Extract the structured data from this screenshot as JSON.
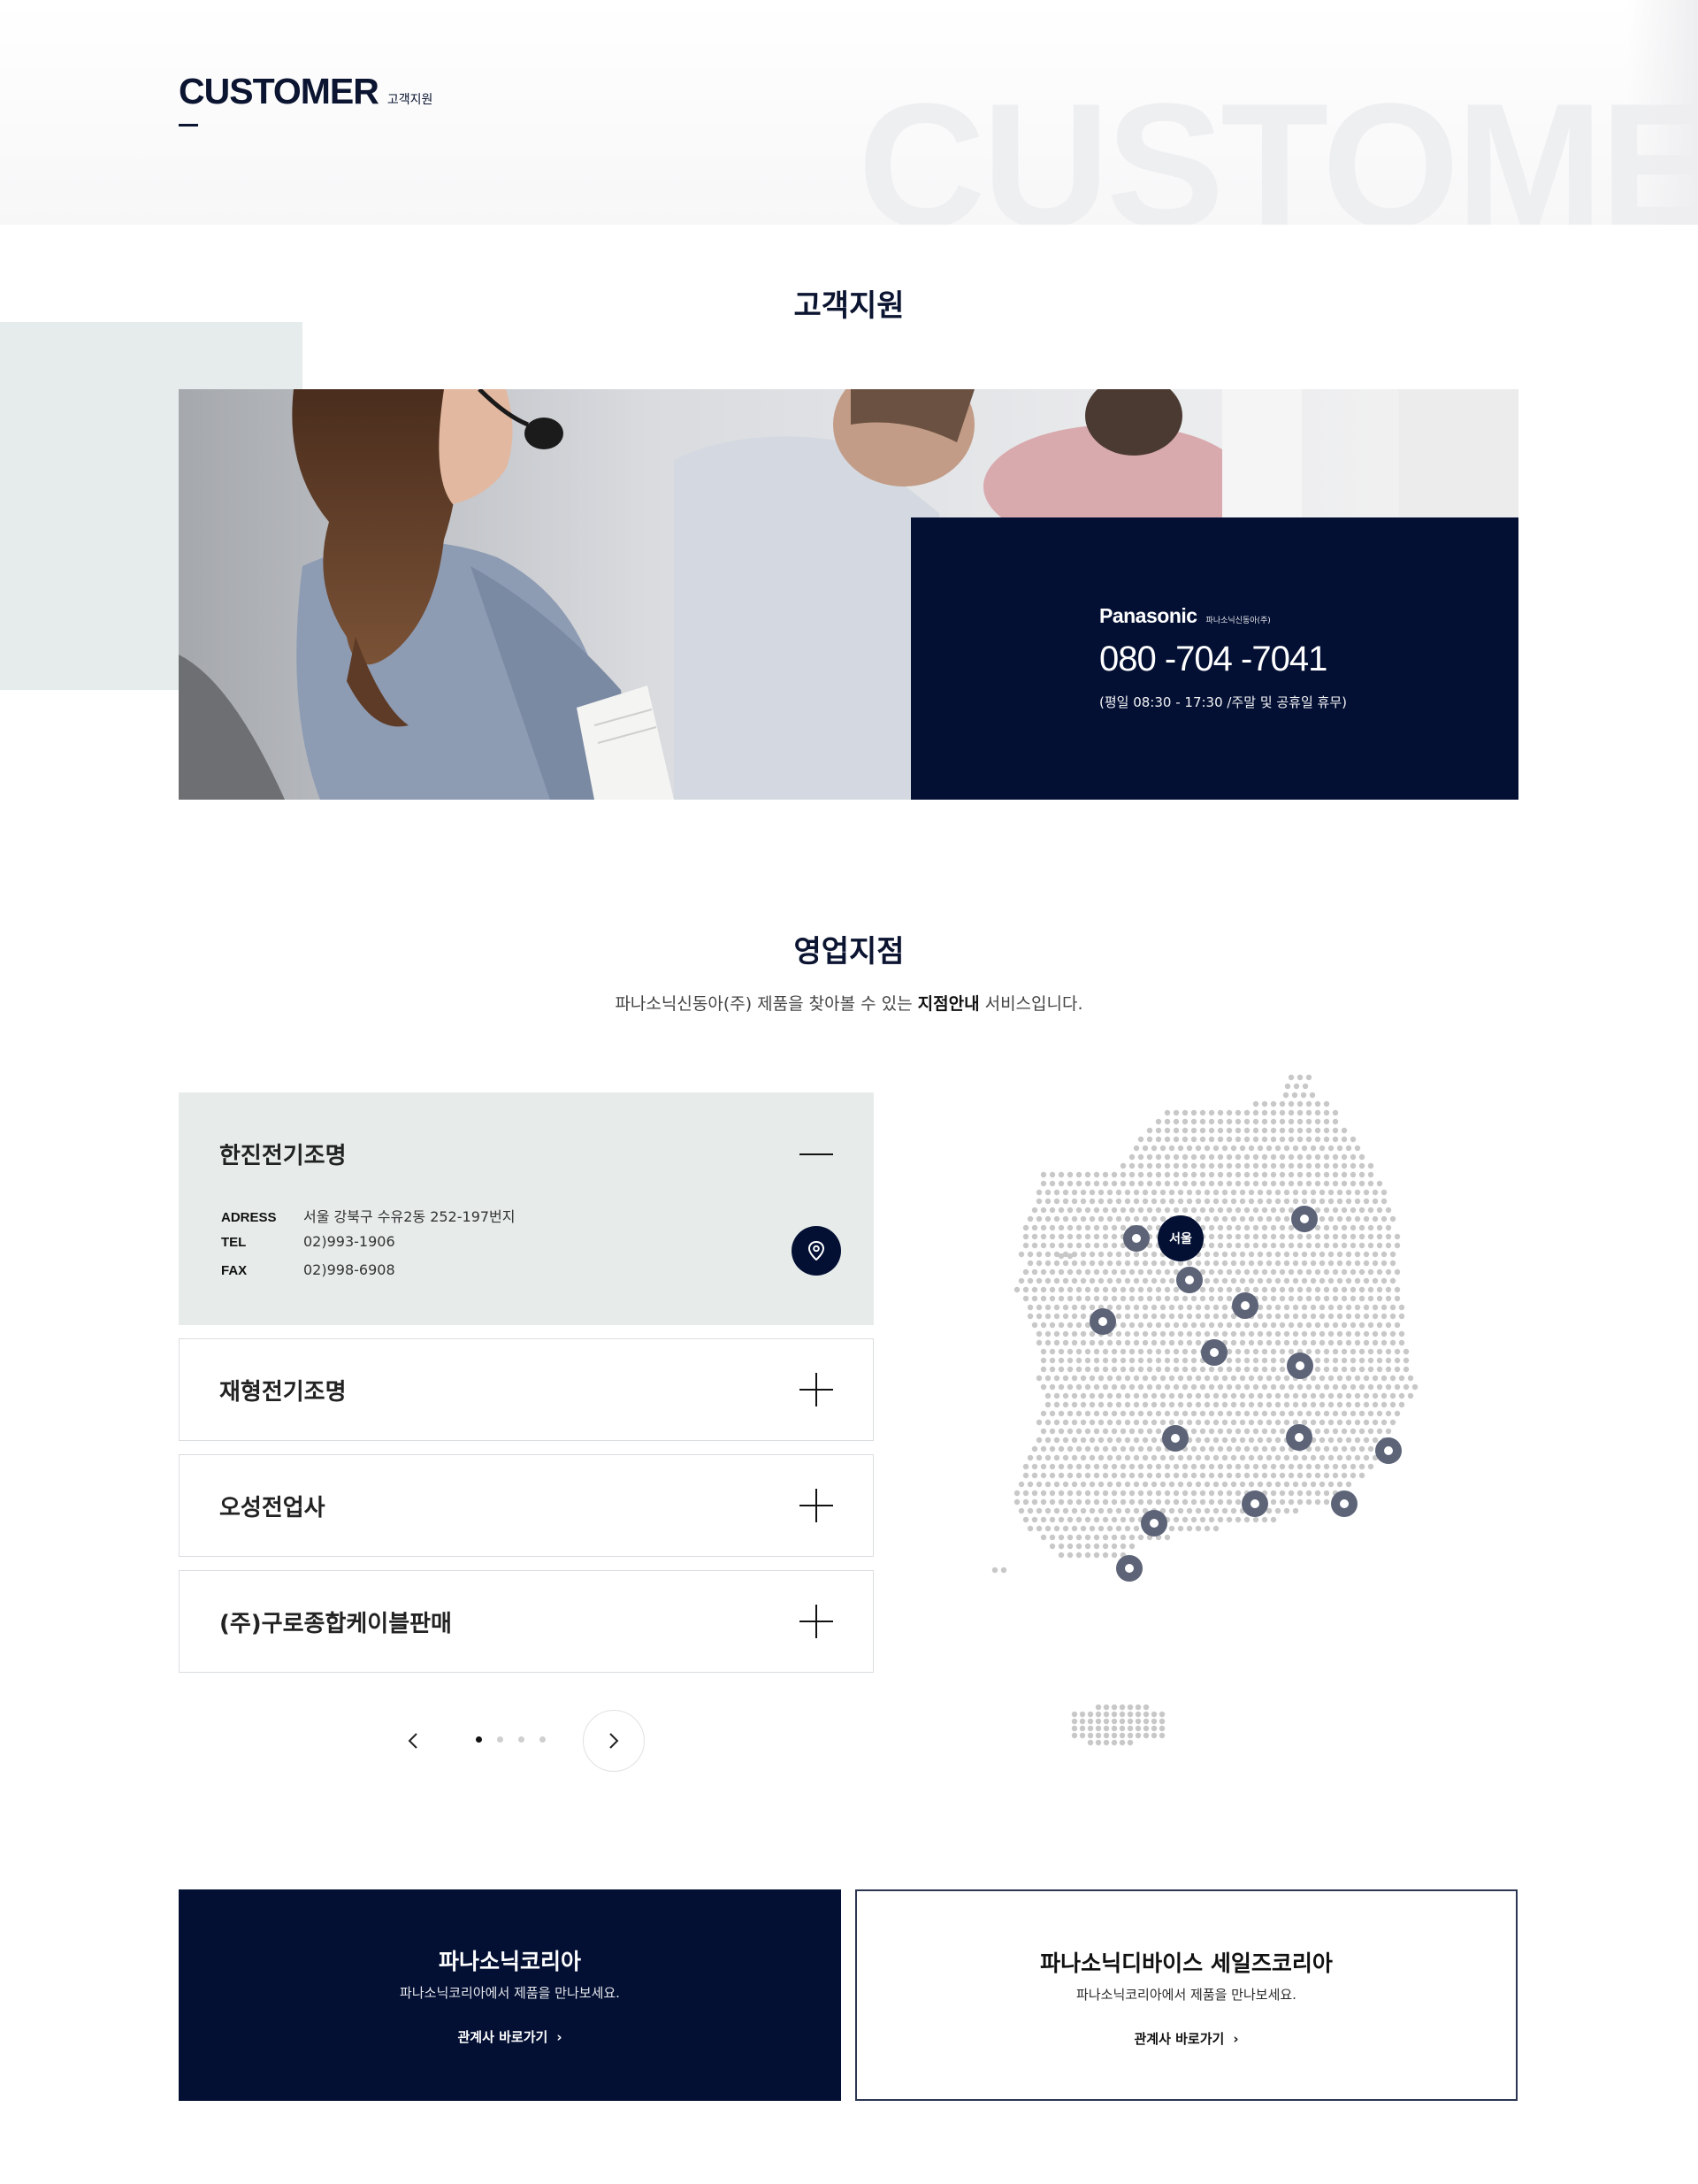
{
  "header": {
    "title_en": "CUSTOMER",
    "title_ko": "고객지원",
    "watermark": "CUSTOMER"
  },
  "support": {
    "section_title": "고객지원",
    "logo": "Panasonic",
    "logo_sub": "파나소닉신동아(주)",
    "phone": "080 -704 -7041",
    "hours": "(평일 08:30 - 17:30 /주말 및 공휴일 휴무)"
  },
  "branches": {
    "section_title": "영업지점",
    "desc_before": "파나소닉신동아(주) 제품을 찾아볼 수 있는 ",
    "desc_bold": "지점안내",
    "desc_after": " 서비스입니다.",
    "items": [
      {
        "name": "한진전기조명",
        "address_label": "ADRESS",
        "address": "서울 강북구 수유2동 252-197번지",
        "tel_label": "TEL",
        "tel": "02)993-1906",
        "fax_label": "FAX",
        "fax": "02)998-6908"
      },
      {
        "name": "재형전기조명"
      },
      {
        "name": "오성전업사"
      },
      {
        "name": "(주)구로종합케이블판매"
      }
    ],
    "pagination": {
      "pages": 4,
      "current": 1
    },
    "map_label": "서울"
  },
  "links": [
    {
      "title": "파나소닉코리아",
      "desc": "파나소닉코리아에서 제품을 만나보세요.",
      "link": "관계사 바로가기"
    },
    {
      "title": "파나소닉디바이스 세일즈코리아",
      "desc": "파나소닉코리아에서 제품을 만나보세요.",
      "link": "관계사 바로가기"
    }
  ],
  "colors": {
    "navy": "#031034",
    "panel": "#e7eceb",
    "dot": "#c8c8c8",
    "marker": "#5d6478"
  }
}
